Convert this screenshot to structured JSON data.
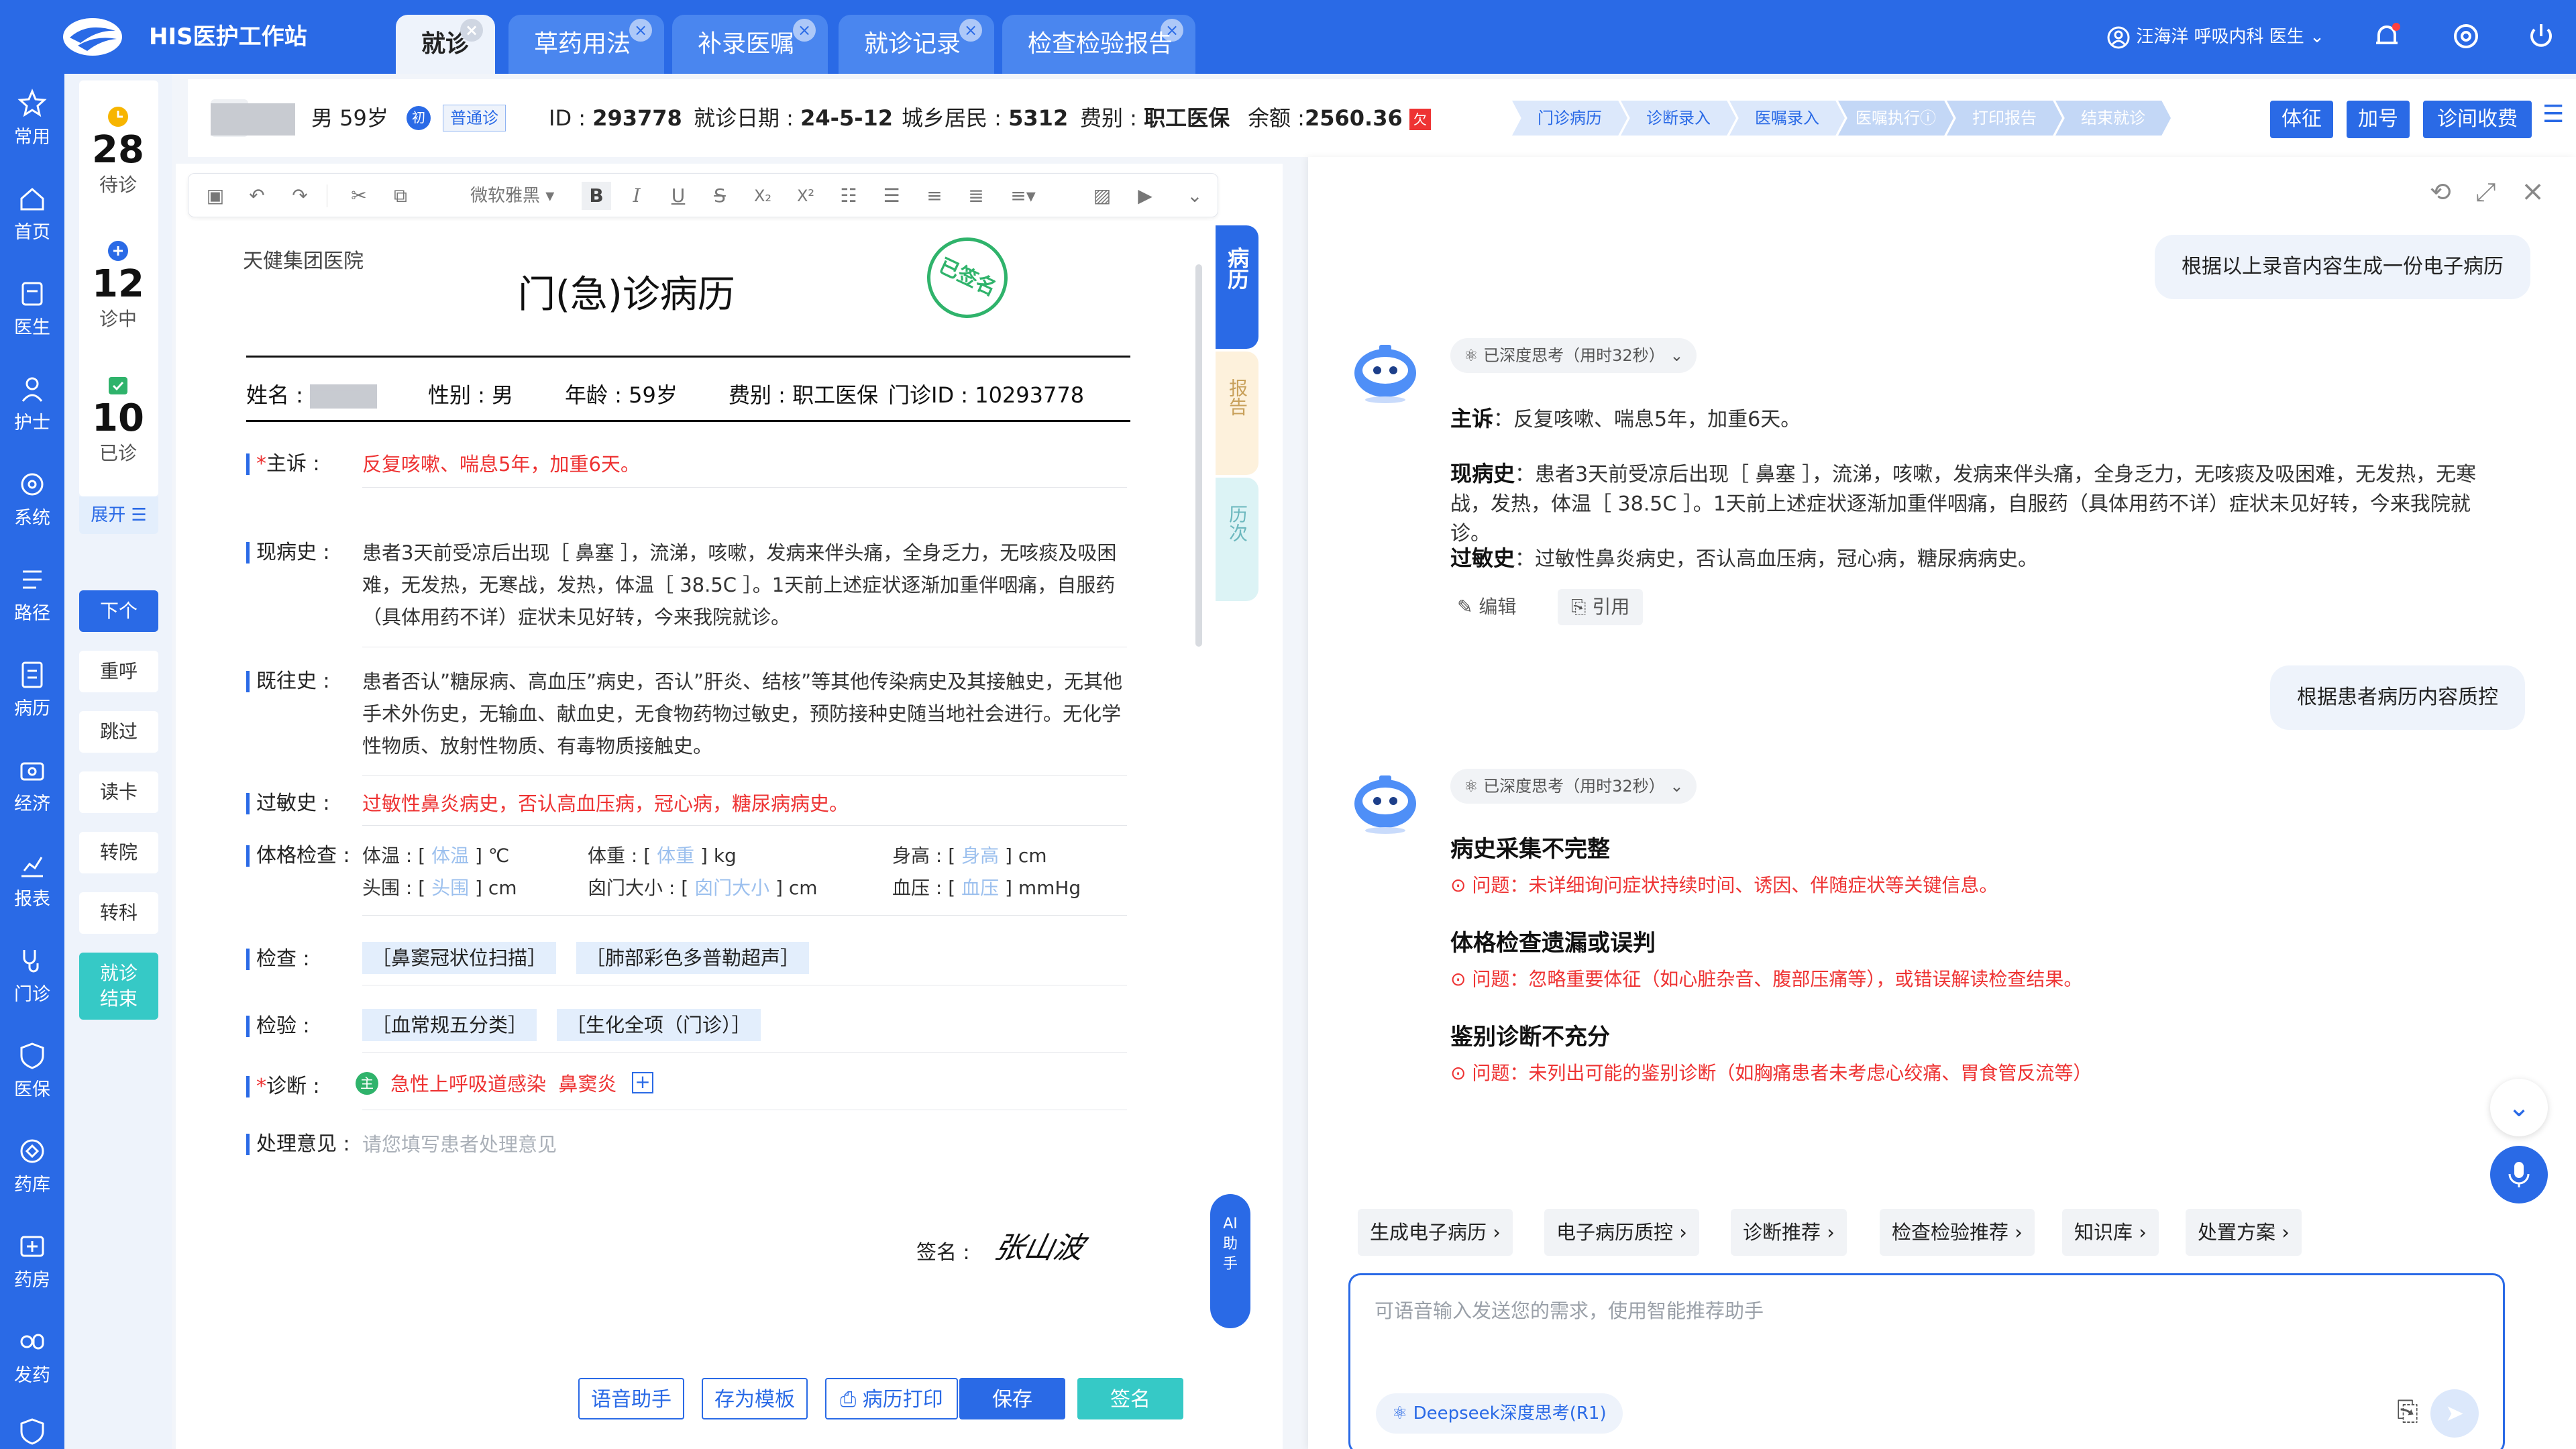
{
  "app": {
    "title": "HIS医护工作站"
  },
  "tabs": [
    {
      "label": "就诊",
      "active": true
    },
    {
      "label": "草药用法"
    },
    {
      "label": "补录医嘱"
    },
    {
      "label": "就诊记录"
    },
    {
      "label": "检查检验报告"
    }
  ],
  "user": {
    "text": "汪海洋  呼吸内科  医生"
  },
  "sidebar": [
    {
      "label": "常用",
      "icon": "star-icon"
    },
    {
      "label": "首页",
      "icon": "home-icon"
    },
    {
      "label": "医生",
      "icon": "doctor-icon"
    },
    {
      "label": "护士",
      "icon": "nurse-icon"
    },
    {
      "label": "系统",
      "icon": "system-icon"
    },
    {
      "label": "路径",
      "icon": "path-icon"
    },
    {
      "label": "病历",
      "icon": "record-icon"
    },
    {
      "label": "经济",
      "icon": "economy-icon"
    },
    {
      "label": "报表",
      "icon": "chart-icon"
    },
    {
      "label": "门诊",
      "icon": "stethoscope-icon"
    },
    {
      "label": "医保",
      "icon": "insurance-icon"
    },
    {
      "label": "药库",
      "icon": "warehouse-icon"
    },
    {
      "label": "药房",
      "icon": "pharmacy-icon"
    },
    {
      "label": "发药",
      "icon": "dispense-icon"
    }
  ],
  "queue": {
    "waiting": {
      "count": "28",
      "label": "待诊"
    },
    "in_progress": {
      "count": "12",
      "label": "诊中"
    },
    "done": {
      "count": "10",
      "label": "已诊"
    },
    "expand": "展开 ☰",
    "buttons": [
      "下个",
      "重呼",
      "跳过",
      "读卡",
      "转院",
      "转科"
    ],
    "finish": "就诊\n结束"
  },
  "patient": {
    "name": "▆▆▆",
    "gender_age": "男  59岁",
    "first_visit_badge": "初",
    "visit_type": "普通诊",
    "id_label": "ID : ",
    "id": "293778",
    "date_label": "就诊日期 : ",
    "date": "24-5-12",
    "resident_label": "城乡居民 : ",
    "resident": "5312",
    "fee_label": "费别 : ",
    "fee": "职工医保",
    "balance_label": "余额 :",
    "balance": "2560.36",
    "balance_badge": "欠"
  },
  "steps": [
    "门诊病历",
    "诊断录入",
    "医嘱录入",
    "医嘱执行ⓘ",
    "打印报告",
    "结束就诊"
  ],
  "header_buttons": [
    "体征",
    "加号",
    "诊间收费"
  ],
  "toolbar": {
    "font": "微软雅黑 ▾"
  },
  "record": {
    "hospital": "天健集团医院",
    "title": "门(急)诊病历",
    "stamp": "已签名",
    "name_label": "姓名 : ",
    "name": "▆▆▆",
    "gender": "性别 : 男",
    "age": "年龄 : 59岁",
    "fee": "费别 : 职工医保",
    "clinic_id": "门诊ID : 10293778",
    "labels": {
      "complaint": "主诉 :",
      "history": "现病史 :",
      "past": "既往史 :",
      "allergy": "过敏史 :",
      "physical": "体格检查 :",
      "exam": "检查 :",
      "lab": "检验 :",
      "diagnosis": "诊断 :",
      "treatment": "处理意见 :"
    },
    "complaint": "反复咳嗽、喘息5年，加重6天。",
    "history": "患者3天前受凉后出现［ 鼻塞 ］，流涕，咳嗽，发病来伴头痛，全身乏力，无咳痰及吸困难，无发热，无寒战，发热，体温［ 38.5C ］。1天前上述症状逐渐加重伴咽痛，自服药（具体用药不详）症状未见好转，今来我院就诊。",
    "past": "患者否认”糖尿病、高血压”病史，否认”肝炎、结核”等其他传染病史及其接触史，无其他手术外伤史，无输血、献血史，无食物药物过敏史，预防接种史随当地社会进行。无化学性物质、放射性物质、有毒物质接触史。",
    "allergy": "过敏性鼻炎病史，否认高血压病，冠心病，糖尿病病史。",
    "physical": {
      "temp_label": "体温 :",
      "temp_ph": "体温",
      "temp_unit": "℃",
      "weight_label": "体重 :",
      "weight_ph": "体重",
      "weight_unit": "kg",
      "height_label": "身高 :",
      "height_ph": "身高",
      "height_unit": "cm",
      "head_label": "头围 :",
      "head_ph": "头围",
      "head_unit": "cm",
      "fontanelle_label": "囟门大小 :",
      "fontanelle_ph": "囟门大小",
      "fontanelle_unit": "cm",
      "bp_label": "血压 :",
      "bp_ph": "血压",
      "bp_unit": "mmHg"
    },
    "exams": [
      "［鼻窦冠状位扫描］",
      "［肺部彩色多普勒超声］"
    ],
    "labs": [
      "［血常规五分类］",
      "［生化全项（门诊）］"
    ],
    "diagnosis_badge": "主",
    "diagnosis": "急性上呼吸道感染  鼻窦炎",
    "treatment_placeholder": "请您填写患者处理意见",
    "sign_label": "签名 :",
    "signature": "张山波"
  },
  "bottom_buttons": [
    "语音助手",
    "存为模板",
    "病历打印",
    "保存",
    "签名"
  ],
  "side_tabs": [
    "病历",
    "报告",
    "历次"
  ],
  "ai_float": "AI助手",
  "chat": {
    "msg1": "根据以上录音内容生成一份电子病历",
    "think1": "已深度思考（用时32秒） ⌄",
    "answer": {
      "complaint_label": "主诉",
      "complaint": "：反复咳嗽、喘息5年，加重6天。",
      "history_label": "现病史",
      "history": "：患者3天前受凉后出现［ 鼻塞 ］，流涕，咳嗽，发病来伴头痛，全身乏力，无咳痰及吸困难，无发热，无寒战，发热，体温［ 38.5C ］。1天前上述症状逐渐加重伴咽痛，自服药（具体用药不详）症状未见好转，今来我院就诊。",
      "allergy_label": "过敏史",
      "allergy": "：过敏性鼻炎病史，否认高血压病，冠心病，糖尿病病史。"
    },
    "edit": "编辑",
    "cite": "引用",
    "msg2": "根据患者病历内容质控",
    "think2": "已深度思考（用时32秒） ⌄",
    "qc": [
      {
        "title": "病史采集不完整",
        "issue": "问题：未详细询问症状持续时间、诱因、伴随症状等关键信息。"
      },
      {
        "title": "体格检查遗漏或误判",
        "issue": "问题：忽略重要体征（如心脏杂音、腹部压痛等），或错误解读检查结果。"
      },
      {
        "title": "鉴别诊断不充分",
        "issue": "问题：未列出可能的鉴别诊断（如胸痛患者未考虑心绞痛、胃食管反流等）"
      }
    ],
    "suggestions": [
      "生成电子病历",
      "电子病历质控",
      "诊断推荐",
      "检查检验推荐",
      "知识库",
      "处置方案"
    ],
    "input_placeholder": "可语音输入发送您的需求，使用智能推荐助手",
    "model": "Deepseek深度思考(R1)"
  },
  "colors": {
    "primary": "#2a6ae6",
    "danger": "#e33333",
    "success": "#2fb36b",
    "teal": "#36c9c6"
  }
}
